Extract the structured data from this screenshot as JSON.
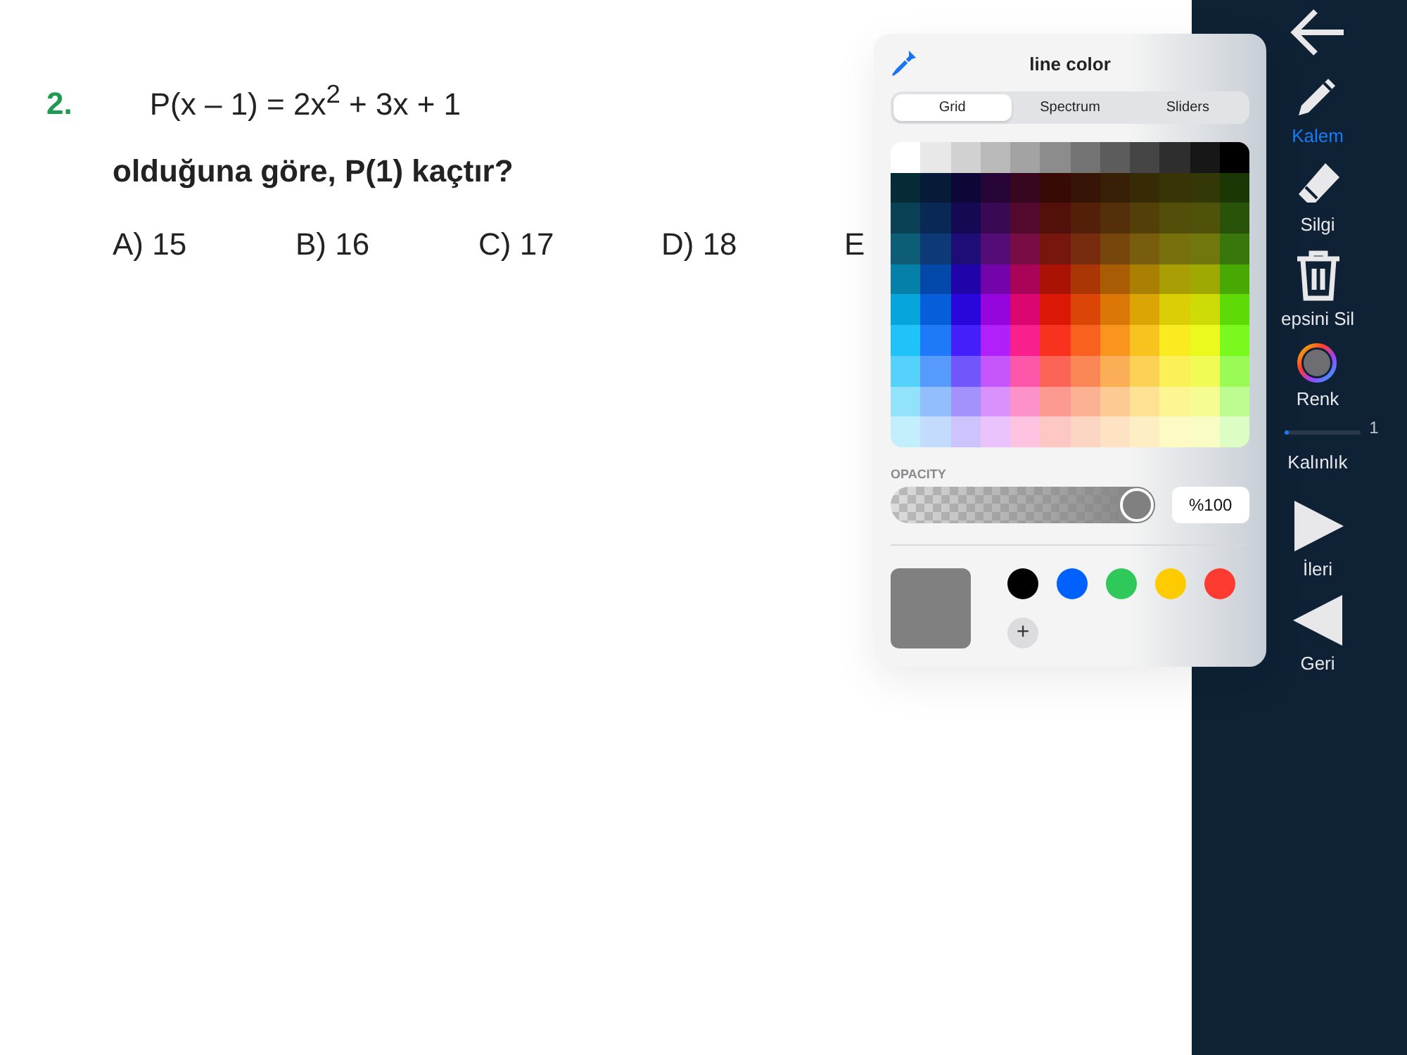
{
  "question": {
    "number": "2.",
    "equation": "P(x – 1) = 2x$^{2}$ + 3x + 1",
    "prompt": "olduğuna göre, P(1) kaçtır?",
    "options": [
      "A) 15",
      "B) 16",
      "C) 17",
      "D) 18",
      "E"
    ]
  },
  "toolbar": [
    {
      "kind": "back"
    },
    {
      "kind": "pen",
      "label": "Kalem",
      "selected": true
    },
    {
      "kind": "eraser",
      "label": "Silgi",
      "selected": false
    },
    {
      "kind": "trash",
      "label": "epsini Sil",
      "selected": false
    },
    {
      "kind": "color",
      "label": "Renk",
      "selected": false
    },
    {
      "kind": "slider",
      "label": "Kalınlık",
      "level": 0.05,
      "reading": "1"
    },
    {
      "kind": "forward",
      "label": "İleri",
      "selected": false
    },
    {
      "kind": "backward",
      "label": "Geri",
      "selected": false
    }
  ],
  "color_picker": {
    "title": "line color",
    "tabs": [
      {
        "label": "Grid",
        "selected": true
      },
      {
        "label": "Spectrum",
        "selected": false
      },
      {
        "label": "Sliders",
        "selected": false
      }
    ],
    "opacity_label": "OPACITY",
    "opacity": {
      "level": 1.0,
      "reading": "%100"
    },
    "current_swatch": {
      "color": "#808080"
    },
    "swatches": [
      {
        "color": "#000000"
      },
      {
        "color": "#0061fe"
      },
      {
        "color": "#2fc85a"
      },
      {
        "color": "#fecb00"
      },
      {
        "color": "#fe3b30"
      }
    ],
    "add_label": "+"
  }
}
